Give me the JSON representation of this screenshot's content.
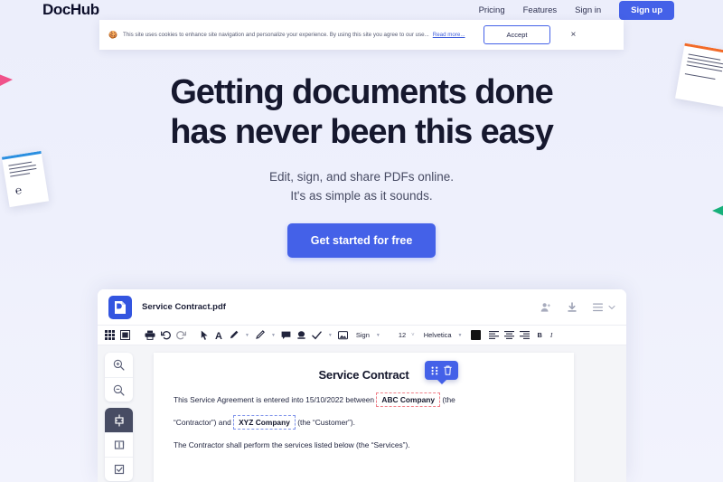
{
  "nav": {
    "logo": "DocHub",
    "links": [
      {
        "label": "Pricing",
        "name": "nav-link-pricing"
      },
      {
        "label": "Features",
        "name": "nav-link-features"
      },
      {
        "label": "Sign in",
        "name": "nav-link-signin"
      }
    ],
    "cta_label": "Sign up"
  },
  "cookie_banner": {
    "emoji": "icon-cookie",
    "message": "This site uses cookies to enhance site navigation and personalize your experience. By using this site you agree to our use...",
    "read_more": "Read more...",
    "accept_label": "Accept",
    "close_label": "×"
  },
  "hero": {
    "headline_line1": "Getting documents done",
    "headline_line2": "has never been this easy",
    "sub_line1": "Edit, sign, and share PDFs online.",
    "sub_line2": "It's as simple as it sounds.",
    "cta_label": "Get started for free"
  },
  "editor": {
    "file_name": "Service Contract.pdf",
    "file_icon": "dochub-document-icon",
    "header_icons": [
      "add-person-icon",
      "download-icon",
      "menu-icon",
      "chevron-down-icon"
    ],
    "toolbar": {
      "items": [
        "grid-view-icon",
        "page-view-icon",
        "print-icon",
        "undo-icon",
        "redo-icon",
        "cursor-icon",
        "text-icon",
        "highlight-icon",
        "pen-icon",
        "comment-icon",
        "stamp-icon",
        "check-icon",
        "image-icon"
      ],
      "sign_label": "Sign",
      "font_size": "12",
      "font_family": "Helvetica",
      "text_color": "#111111",
      "align_icons": [
        "align-left-icon",
        "align-center-icon",
        "align-right-icon"
      ],
      "bold_label": "B",
      "italic_label": "I"
    },
    "rail": {
      "zoom_in": "zoom-in-icon",
      "zoom_out": "zoom-out-icon",
      "tools": [
        "text-field-tool-icon",
        "signature-field-tool-icon",
        "checkbox-field-tool-icon"
      ]
    },
    "document": {
      "title": "Service Contract",
      "para1_before": "This Service Agreement is entered into 15/10/2022 between",
      "field1": "ABC Company",
      "para1_after": "(the",
      "para2_before": "“Contractor”) and",
      "field2": "XYZ Company",
      "para2_after": "(the “Customer”).",
      "para3": "The Contractor shall perform the services listed below (the “Services”).",
      "popover_icons": [
        "drag-handle-icon",
        "delete-icon"
      ]
    }
  },
  "colors": {
    "brand": "#4461e8",
    "page_bg": "#eef0fb",
    "heading": "#16182e",
    "accent_pink": "#f0528a",
    "accent_green": "#16b07a",
    "accent_orange": "#f26a28",
    "accent_blue": "#2b8fe0"
  }
}
